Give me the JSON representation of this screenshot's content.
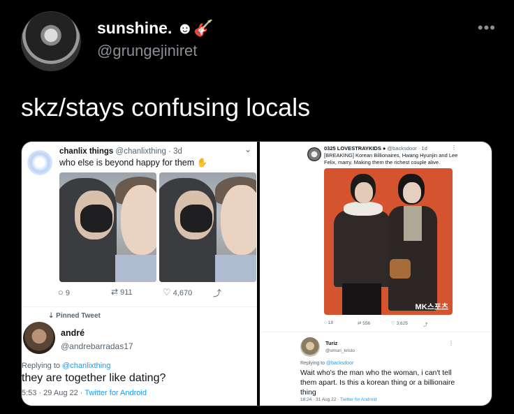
{
  "header": {
    "display_name": "sunshine.",
    "name_emojis": "☻🎸",
    "handle": "@grungejiniret",
    "more": "•••"
  },
  "tweet": {
    "text": "skz/stays confusing locals"
  },
  "screenshot_left": {
    "author_name": "chanlix things",
    "author_handle": "@chanlixthing · 3d",
    "text": "who else is beyond happy for them ✋",
    "replies": "9",
    "retweets": "911",
    "likes": "4,670",
    "pinned_label": "Pinned Tweet",
    "reply_author_name": "andré",
    "reply_author_handle": "@andrebarradas17",
    "replying_prefix": "Replying to",
    "replying_to": "@chanlixthing",
    "reply_text": "they are together like dating?",
    "reply_time": "5:53 · 29 Aug 22 ·",
    "reply_client": "Twitter for Android"
  },
  "screenshot_right": {
    "author_name": "0325 LOVESTRAYKIDS ●",
    "author_handle": "@backsdoor · 1d",
    "text": "[BREAKING] Korean Billionaires, Hwang Hyunjin and Lee Felix, marry. Making them the richest couple alive.",
    "watermark": "MK스포츠",
    "replies": "18",
    "retweets": "556",
    "likes": "3,625",
    "reply_author_name": "Turiz",
    "reply_author_handle": "@omuri_kristo",
    "replying_prefix": "Replying to",
    "replying_to": "@backsdoor",
    "reply_text": "Wait who's the man who the woman, i can't tell them apart. Is this a korean thing or a billionaire thing",
    "reply_time": "18:24 · 31 Aug 22 ·",
    "reply_client": "Twitter for Android"
  },
  "icons": {
    "reply": "💬",
    "retweet": "⇄",
    "like": "♡",
    "share": "⤴",
    "pin": "📌"
  }
}
